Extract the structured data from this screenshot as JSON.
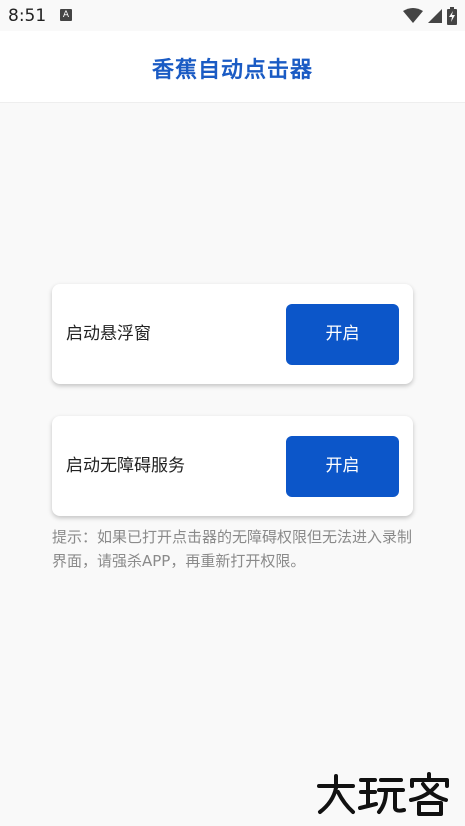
{
  "status_bar": {
    "time": "8:51",
    "notification_icon": "a-icon",
    "icons": [
      "wifi-icon",
      "signal-icon",
      "battery-charging-icon"
    ]
  },
  "app_bar": {
    "title": "香蕉自动点击器"
  },
  "cards": [
    {
      "label": "启动悬浮窗",
      "button_label": "开启"
    },
    {
      "label": "启动无障碍服务",
      "button_label": "开启"
    }
  ],
  "hint": "提示：如果已打开点击器的无障碍权限但无法进入录制界面，请强杀APP，再重新打开权限。",
  "watermark": "大玩客",
  "colors": {
    "accent": "#1a5bc4",
    "button": "#0c56c9",
    "background": "#f9f9f9",
    "hint_text": "#8a8a8a"
  }
}
